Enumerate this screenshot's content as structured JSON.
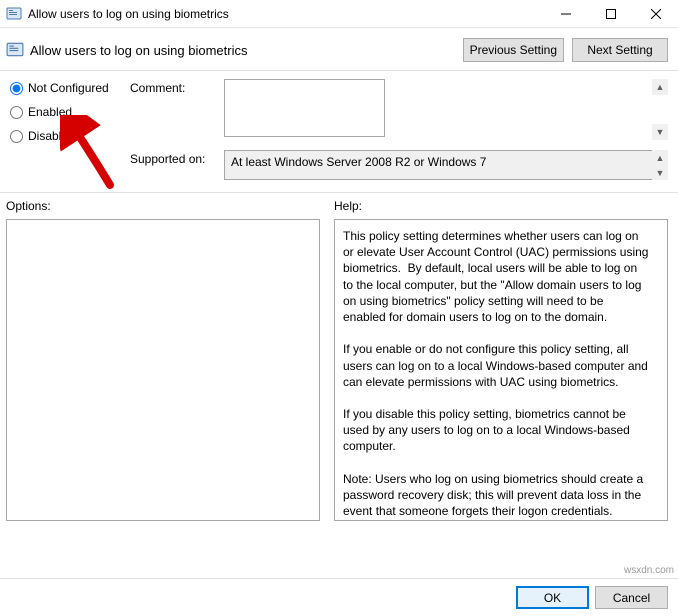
{
  "window": {
    "title": "Allow users to log on using biometrics"
  },
  "header": {
    "title": "Allow users to log on using biometrics",
    "prev": "Previous Setting",
    "next": "Next Setting"
  },
  "radios": {
    "not_configured": "Not Configured",
    "enabled": "Enabled",
    "disabled": "Disabled",
    "selected": "not_configured"
  },
  "labels": {
    "comment": "Comment:",
    "supported_on": "Supported on:",
    "options": "Options:",
    "help": "Help:"
  },
  "comment": "",
  "supported_on": "At least Windows Server 2008 R2 or Windows 7",
  "help_text": "This policy setting determines whether users can log on or elevate User Account Control (UAC) permissions using biometrics.  By default, local users will be able to log on to the local computer, but the \"Allow domain users to log on using biometrics\" policy setting will need to be enabled for domain users to log on to the domain.\n\nIf you enable or do not configure this policy setting, all users can log on to a local Windows-based computer and can elevate permissions with UAC using biometrics.\n\nIf you disable this policy setting, biometrics cannot be used by any users to log on to a local Windows-based computer.\n\nNote: Users who log on using biometrics should create a password recovery disk; this will prevent data loss in the event that someone forgets their logon credentials.",
  "footer": {
    "ok": "OK",
    "cancel": "Cancel"
  },
  "watermark": "wsxdn.com"
}
